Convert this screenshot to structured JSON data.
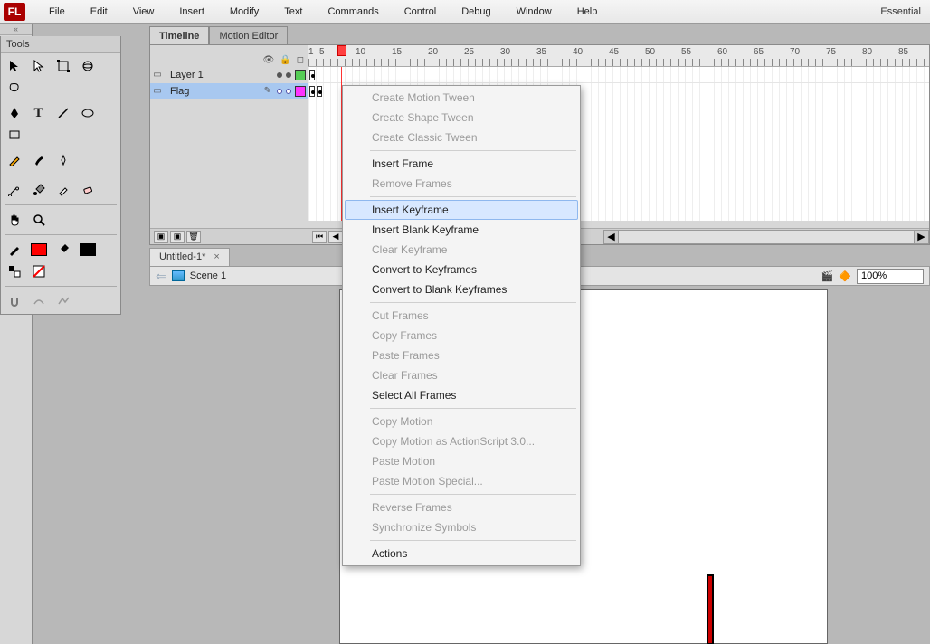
{
  "app": {
    "logo": "FL",
    "workspace": "Essential"
  },
  "menus": [
    "File",
    "Edit",
    "View",
    "Insert",
    "Modify",
    "Text",
    "Commands",
    "Control",
    "Debug",
    "Window",
    "Help"
  ],
  "tools_panel": {
    "title": "Tools"
  },
  "panel_tabs": {
    "timeline": "Timeline",
    "motion_editor": "Motion Editor"
  },
  "ruler": [
    "1",
    "5",
    "10",
    "15",
    "20",
    "25",
    "30",
    "35",
    "40",
    "45",
    "50",
    "55",
    "60",
    "65",
    "70",
    "75",
    "80",
    "85"
  ],
  "layers": [
    {
      "name": "Layer 1",
      "selected": false,
      "color": "green"
    },
    {
      "name": "Flag",
      "selected": true,
      "color": "mag"
    }
  ],
  "document": {
    "tab": "Untitled-1*",
    "scene": "Scene 1",
    "zoom": "100%"
  },
  "context_menu": {
    "g1": [
      "Create Motion Tween",
      "Create Shape Tween",
      "Create Classic Tween"
    ],
    "g2": [
      {
        "label": "Insert Frame",
        "enabled": true
      },
      {
        "label": "Remove Frames",
        "enabled": false
      }
    ],
    "g3": [
      {
        "label": "Insert Keyframe",
        "enabled": true,
        "hl": true
      },
      {
        "label": "Insert Blank Keyframe",
        "enabled": true
      },
      {
        "label": "Clear Keyframe",
        "enabled": false
      },
      {
        "label": "Convert to Keyframes",
        "enabled": true
      },
      {
        "label": "Convert to Blank Keyframes",
        "enabled": true
      }
    ],
    "g4": [
      "Cut Frames",
      "Copy Frames",
      "Paste Frames",
      "Clear Frames"
    ],
    "g4b": {
      "label": "Select All Frames"
    },
    "g5": [
      "Copy Motion",
      "Copy Motion as ActionScript 3.0...",
      "Paste Motion",
      "Paste Motion Special..."
    ],
    "g6": [
      "Reverse Frames",
      "Synchronize Symbols"
    ],
    "g7": {
      "label": "Actions"
    }
  }
}
